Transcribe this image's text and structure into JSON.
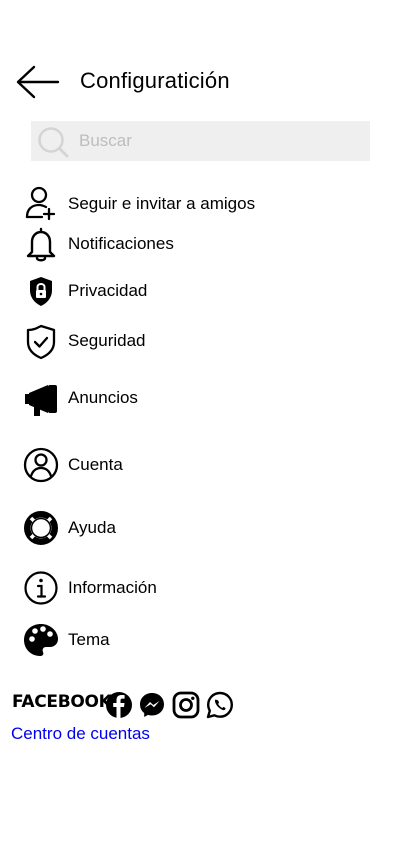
{
  "header": {
    "title": "Configuratición",
    "back_icon": "arrow-left-icon"
  },
  "search": {
    "placeholder": "Buscar",
    "value": "",
    "icon": "search-icon"
  },
  "menu": [
    {
      "label": "Seguir e invitar a amigos",
      "icon": "person-add-icon"
    },
    {
      "label": "Notificaciones",
      "icon": "bell-icon"
    },
    {
      "label": "Privacidad",
      "icon": "shield-lock-icon"
    },
    {
      "label": "Seguridad",
      "icon": "shield-check-icon"
    },
    {
      "label": "Anuncios",
      "icon": "megaphone-icon"
    },
    {
      "label": "Cuenta",
      "icon": "account-circle-icon"
    },
    {
      "label": "Ayuda",
      "icon": "lifebuoy-icon"
    },
    {
      "label": "Información",
      "icon": "info-icon"
    },
    {
      "label": "Tema",
      "icon": "palette-icon"
    }
  ],
  "footer": {
    "brand": "FACEBOOK",
    "app_icons": [
      "facebook-icon",
      "messenger-icon",
      "instagram-icon",
      "whatsapp-icon"
    ],
    "link": "Centro de cuentas",
    "link_color": "#0000ee"
  }
}
